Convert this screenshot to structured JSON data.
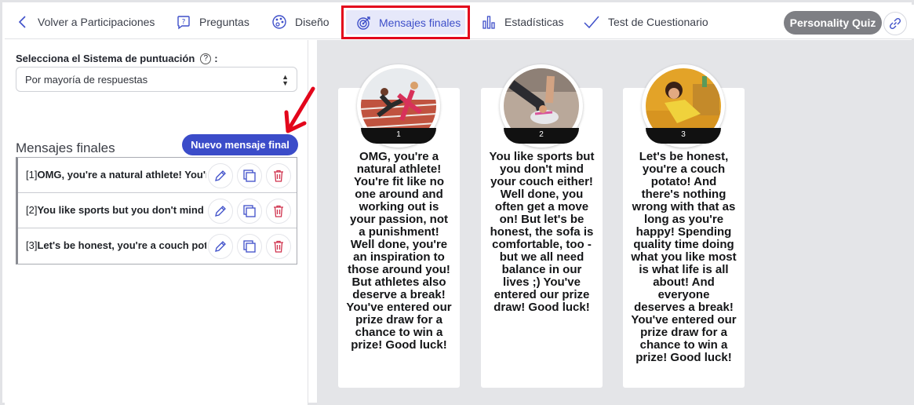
{
  "nav": {
    "back": "Volver a Participaciones",
    "preguntas": "Preguntas",
    "diseno": "Diseño",
    "mensajes": "Mensajes finales",
    "estadisticas": "Estadísticas",
    "test": "Test de Cuestionario",
    "quiz_badge": "Personality Quiz"
  },
  "left": {
    "score_label": "Selecciona el Sistema de puntuación",
    "score_colon": ":",
    "help_glyph": "?",
    "select_value": "Por mayoría de respuestas",
    "section_title": "Mensajes finales",
    "new_button": "Nuevo mensaje final",
    "messages": [
      {
        "index": "[1]",
        "text": "OMG, you're a natural athlete! You're fit like no one around"
      },
      {
        "index": "[2]",
        "text": "You like sports but you don't mind your couch either!"
      },
      {
        "index": "[3]",
        "text": "Let's be honest, you're a couch potato!"
      }
    ]
  },
  "cards": [
    {
      "number": "1",
      "text": "OMG, you're a natural athlete! You're fit like no one around and working out is your passion, not a punishment! Well done, you're an inspiration to those around you! But athletes also deserve a break! You've entered our prize draw for a chance to win a prize! Good luck!"
    },
    {
      "number": "2",
      "text": "You like sports but you don't mind your couch either! Well done, you often get a move on! But let's be honest, the sofa is comfortable, too - but we all need balance in our lives ;) You've entered our prize draw! Good luck!"
    },
    {
      "number": "3",
      "text": "Let's be honest, you're a couch potato! And there's nothing wrong with that as long as you're happy! Spending quality time doing what you like most is what life is all about! And everyone deserves a break! You've entered our prize draw for a chance to win a prize! Good luck!"
    }
  ],
  "colors": {
    "accent": "#3b4cc9",
    "active_tab_bg": "#e6e8fa",
    "highlight_border": "#e3061b",
    "badge_gray": "#7e7f84",
    "preview_bg": "#e4e5e8"
  },
  "icons": [
    "chevron-left-icon",
    "question-icon",
    "palette-icon",
    "target-icon",
    "bar-chart-icon",
    "check-icon",
    "link-icon",
    "pencil-icon",
    "duplicate-icon",
    "trash-icon",
    "red-arrow-icon"
  ]
}
